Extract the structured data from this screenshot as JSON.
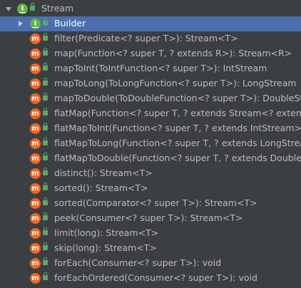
{
  "tree": {
    "root": {
      "label": "Stream",
      "icon": "interface-icon",
      "expanded": true
    },
    "builder": {
      "label": "Builder",
      "icon": "interface-icon",
      "collapsed": true,
      "selected": true
    },
    "methods": [
      {
        "label": "filter(Predicate<? super T>): Stream<T>"
      },
      {
        "label": "map(Function<? super T, ? extends R>): Stream<R>"
      },
      {
        "label": "mapToInt(ToIntFunction<? super T>): IntStream"
      },
      {
        "label": "mapToLong(ToLongFunction<? super T>): LongStream"
      },
      {
        "label": "mapToDouble(ToDoubleFunction<? super T>): DoubleStrea"
      },
      {
        "label": "flatMap(Function<? super T, ? extends Stream<? extends R"
      },
      {
        "label": "flatMapToInt(Function<? super T, ? extends IntStream>): In"
      },
      {
        "label": "flatMapToLong(Function<? super T, ? extends LongStream"
      },
      {
        "label": "flatMapToDouble(Function<? super T, ? extends DoubleStr"
      },
      {
        "label": "distinct(): Stream<T>"
      },
      {
        "label": "sorted(): Stream<T>"
      },
      {
        "label": "sorted(Comparator<? super T>): Stream<T>"
      },
      {
        "label": "peek(Consumer<? super T>): Stream<T>"
      },
      {
        "label": "limit(long): Stream<T>"
      },
      {
        "label": "skip(long): Stream<T>"
      },
      {
        "label": "forEach(Consumer<? super T>): void"
      },
      {
        "label": "forEachOrdered(Consumer<? super T>): void"
      }
    ],
    "icon_letters": {
      "interface": "I",
      "method": "m"
    }
  },
  "colors": {
    "background": "#3c3f41",
    "selection": "#4b6eaf",
    "text": "#bbbbbb",
    "interface_icon": "#62b543",
    "method_icon": "#f26522",
    "public_lock": "#59a869"
  }
}
